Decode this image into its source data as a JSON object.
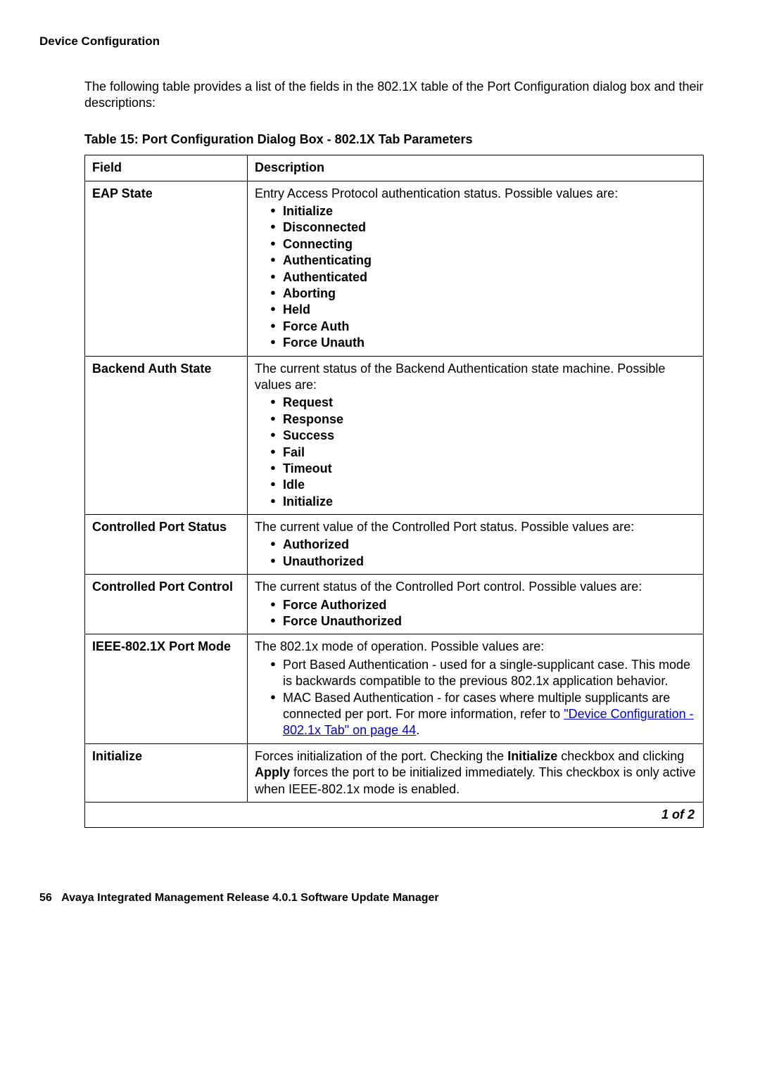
{
  "section_title": "Device Configuration",
  "intro": "The following table provides a list of the fields in the 802.1X table of the Port Configuration dialog box and their descriptions:",
  "table_caption": "Table 15: Port Configuration Dialog Box - 802.1X Tab Parameters",
  "headers": {
    "field": "Field",
    "description": "Description"
  },
  "rows": {
    "eap_state": {
      "field": "EAP State",
      "desc_intro": "Entry Access Protocol authentication status. Possible values are:",
      "bullets": [
        "Initialize",
        "Disconnected",
        "Connecting",
        "Authenticating",
        "Authenticated",
        "Aborting",
        "Held",
        "Force Auth",
        "Force Unauth"
      ]
    },
    "backend_auth_state": {
      "field": "Backend Auth State",
      "desc_intro": "The current status of the Backend Authentication state machine. Possible values are:",
      "bullets": [
        "Request",
        "Response",
        "Success",
        "Fail",
        "Timeout",
        "Idle",
        "Initialize"
      ]
    },
    "controlled_port_status": {
      "field": "Controlled Port Status",
      "desc_intro": "The current value of the Controlled Port status. Possible values are:",
      "bullets": [
        "Authorized",
        "Unauthorized"
      ]
    },
    "controlled_port_control": {
      "field": "Controlled Port Control",
      "desc_intro": "The current status of the Controlled Port control. Possible values are:",
      "bullets": [
        "Force Authorized",
        "Force Unauthorized"
      ]
    },
    "ieee_port_mode": {
      "field": "IEEE-802.1X Port Mode",
      "desc_intro": "The 802.1x mode of operation. Possible values are:",
      "bullet1a": "Port Based Authentication - used for a single-supplicant case. This mode is backwards compatible to the previous 802.1x application behavior.",
      "bullet2a": "MAC Based Authentication - for cases where multiple supplicants are connected per port. For more information, refer to ",
      "bullet2_link": "\"Device Configuration - 802.1x Tab\" on page 44",
      "bullet2_tail": "."
    },
    "initialize": {
      "field": "Initialize",
      "desc_a": "Forces initialization of the port. Checking the ",
      "desc_b_bold": "Initialize",
      "desc_c": " checkbox and clicking ",
      "desc_d_bold": "Apply",
      "desc_e": " forces the port to be initialized immediately. This checkbox is only active when IEEE-802.1x mode is enabled."
    }
  },
  "pager": "1 of 2",
  "footer_page": "56",
  "footer_text": "Avaya Integrated Management Release 4.0.1 Software Update Manager"
}
